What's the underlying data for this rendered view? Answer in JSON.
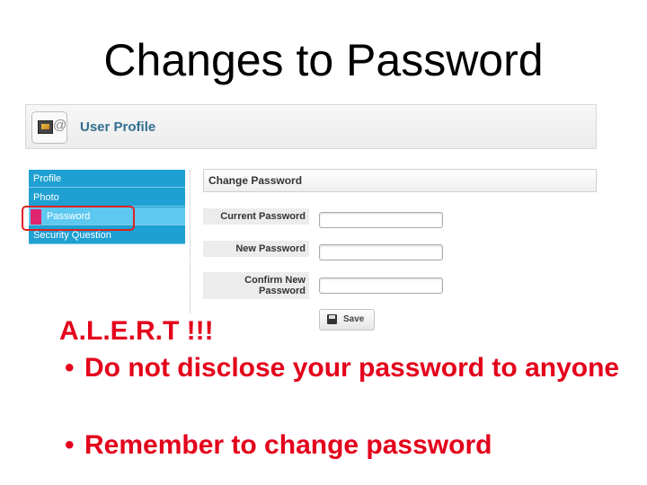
{
  "slide": {
    "title": "Changes to Password"
  },
  "header": {
    "title": "User Profile",
    "icon": "profile-photo-at-icon"
  },
  "sidebar": {
    "items": [
      {
        "label": "Profile"
      },
      {
        "label": "Photo"
      },
      {
        "label": "Password",
        "active": true
      },
      {
        "label": "Security Question"
      }
    ],
    "colors": {
      "background": "#1fa0d2",
      "active": "#5ec9f0",
      "marker": "#e0246e",
      "highlight": "#e02020"
    }
  },
  "form": {
    "heading": "Change Password",
    "fields": [
      {
        "label": "Current Password",
        "value": ""
      },
      {
        "label": "New Password",
        "value": ""
      },
      {
        "label": "Confirm New Password",
        "value": ""
      }
    ],
    "save_label": "Save"
  },
  "alert": {
    "title": "A.L.E.R.T !!!",
    "bullets": [
      "Do not disclose your password to anyone",
      "Remember to change password"
    ],
    "color": "#e4001b"
  }
}
